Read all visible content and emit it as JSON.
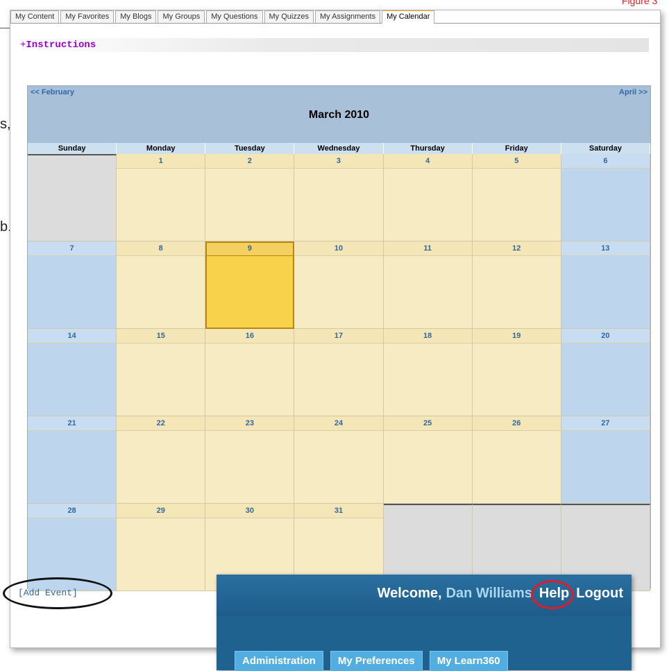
{
  "figure_label": "Figure 3",
  "background_fragments": [
    "s,",
    "b."
  ],
  "tabs": [
    {
      "label": "My Content",
      "active": false
    },
    {
      "label": "My Favorites",
      "active": false
    },
    {
      "label": "My Blogs",
      "active": false
    },
    {
      "label": "My Groups",
      "active": false
    },
    {
      "label": "My Questions",
      "active": false
    },
    {
      "label": "My Quizzes",
      "active": false
    },
    {
      "label": "My Assignments",
      "active": false
    },
    {
      "label": "My Calendar",
      "active": true
    }
  ],
  "instructions": {
    "toggle": "+",
    "label": "Instructions"
  },
  "calendar": {
    "prev_label": "<< February",
    "next_label": "April >>",
    "month_title": "March  2010",
    "days_of_week": [
      "Sunday",
      "Monday",
      "Tuesday",
      "Wednesday",
      "Thursday",
      "Friday",
      "Saturday"
    ],
    "today": 9,
    "weeks": [
      [
        null,
        1,
        2,
        3,
        4,
        5,
        6
      ],
      [
        7,
        8,
        9,
        10,
        11,
        12,
        13
      ],
      [
        14,
        15,
        16,
        17,
        18,
        19,
        20
      ],
      [
        21,
        22,
        23,
        24,
        25,
        26,
        27
      ],
      [
        28,
        29,
        30,
        31,
        null,
        null,
        null
      ]
    ]
  },
  "add_event_label": "[Add Event]",
  "header_overlay": {
    "welcome_prefix": "Welcome,",
    "user_name": "Dan Williams",
    "help_label": "Help",
    "logout_label": "Logout",
    "buttons": [
      "Administration",
      "My Preferences",
      "My Learn360"
    ]
  },
  "colors": {
    "annotation_red": "#e01b2b",
    "link_blue": "#336699",
    "instructions_purple": "#9900cc",
    "today_yellow": "#f8d24a"
  }
}
